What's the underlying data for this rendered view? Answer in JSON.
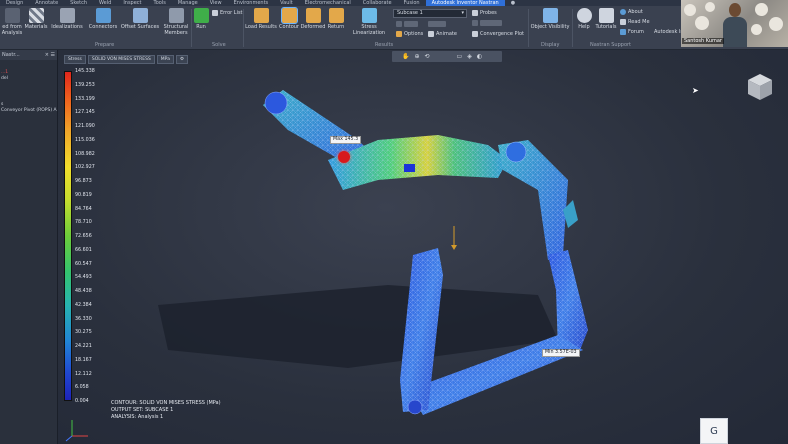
{
  "tabs": [
    "Design",
    "Annotate",
    "Sketch",
    "Weld",
    "Inspect",
    "Tools",
    "Manage",
    "View",
    "Environments",
    "Vault",
    "Electromechanical",
    "Collaborate",
    "Fusion",
    "Autodesk Inventor Nastran",
    "●"
  ],
  "active_tab": "Autodesk Inventor Nastran",
  "ribbon": {
    "buttons": [
      {
        "label": "ed from\nAnalysis",
        "color": "#5a6272"
      },
      {
        "label": "Materials",
        "color": "#8f9aab"
      },
      {
        "label": "Idealizations",
        "color": "#8f9aab"
      },
      {
        "label": "Connectors",
        "color": "#5b9bd5"
      },
      {
        "label": "Offset Surfaces",
        "color": "#8fb0d8"
      },
      {
        "label": "Structural\nMembers",
        "color": "#8f9aab"
      },
      {
        "label": "Run",
        "color": "#3fae49"
      },
      {
        "label": "Load Results",
        "color": "#e3a84a"
      },
      {
        "label": "Contour",
        "color": "#e3a84a"
      },
      {
        "label": "Deformed",
        "color": "#e3a84a"
      },
      {
        "label": "Return",
        "color": "#e3a84a"
      },
      {
        "label": "Stress Linearization",
        "color": "#6dbbe8"
      },
      {
        "label": "Object Visibility",
        "color": "#7fb4e8"
      },
      {
        "label": "Help",
        "color": "#cfd5df"
      },
      {
        "label": "Tutorials",
        "color": "#cfd5df"
      }
    ],
    "small": {
      "error_list": "Error List",
      "options": "Options",
      "animate": "Animate",
      "probes": "Probes",
      "convergence_plot": "Convergence Plot",
      "about": "About",
      "read_me": "Read Me",
      "forum": "Forum",
      "autodesk": "Autodesk In"
    },
    "subcase": "Subcase 1",
    "groups": {
      "prepare": "Prepare",
      "solve": "Solve",
      "results": "Results",
      "display": "Display",
      "support": "Nastran Support"
    }
  },
  "webcam": {
    "name": "Santosh Kumar"
  },
  "browser": {
    "title": "Nastr...",
    "items": [
      {
        "text": "...1",
        "red": true
      },
      {
        "text": "del",
        "red": false
      },
      {
        "text": "s",
        "red": false
      },
      {
        "text": "Conveyor Pivot (ROPS) A",
        "red": false
      }
    ]
  },
  "viewport": {
    "result_type": "Stress",
    "component": "SOLID VON MISES STRESS",
    "unit": "MPa",
    "max_label": "Max 145.3",
    "min_label": "Min 3.57E-03",
    "legend": [
      "145.338",
      "139.253",
      "133.199",
      "127.145",
      "121.090",
      "115.036",
      "108.982",
      "102.927",
      "96.873",
      "90.819",
      "84.764",
      "78.710",
      "72.656",
      "66.601",
      "60.547",
      "54.493",
      "48.438",
      "42.384",
      "36.330",
      "30.275",
      "24.221",
      "18.167",
      "12.112",
      "6.058",
      "0.004"
    ],
    "info": [
      "CONTOUR: SOLID VON MISES STRESS (MPa)",
      "OUTPUT SET: SUBCASE 1",
      "ANALYSIS: Analysis 1"
    ],
    "g_label": "G"
  }
}
